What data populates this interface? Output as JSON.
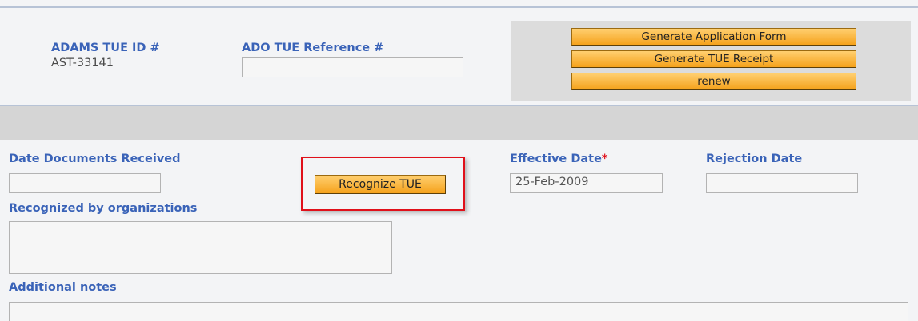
{
  "header": {
    "adams_tue_id_label": "ADAMS TUE ID #",
    "adams_tue_id_value": "AST-33141",
    "ado_reference_label": "ADO TUE Reference #",
    "ado_reference_value": ""
  },
  "actions": {
    "generate_application_form": "Generate Application Form",
    "generate_tue_receipt": "Generate TUE Receipt",
    "renew": "renew"
  },
  "form": {
    "date_documents_received_label": "Date Documents Received",
    "date_documents_received_value": "",
    "recognize_tue_button": "Recognize TUE",
    "effective_date_label": "Effective Date",
    "effective_date_required_mark": "*",
    "effective_date_value": "25-Feb-2009",
    "rejection_date_label": "Rejection Date",
    "rejection_date_value": "",
    "recognized_by_label": "Recognized by organizations",
    "recognized_by_value": "",
    "additional_notes_label": "Additional notes",
    "additional_notes_value": ""
  },
  "colors": {
    "label_blue": "#3a63b8",
    "button_orange": "#f5a21c",
    "highlight_red": "#e0101a"
  }
}
